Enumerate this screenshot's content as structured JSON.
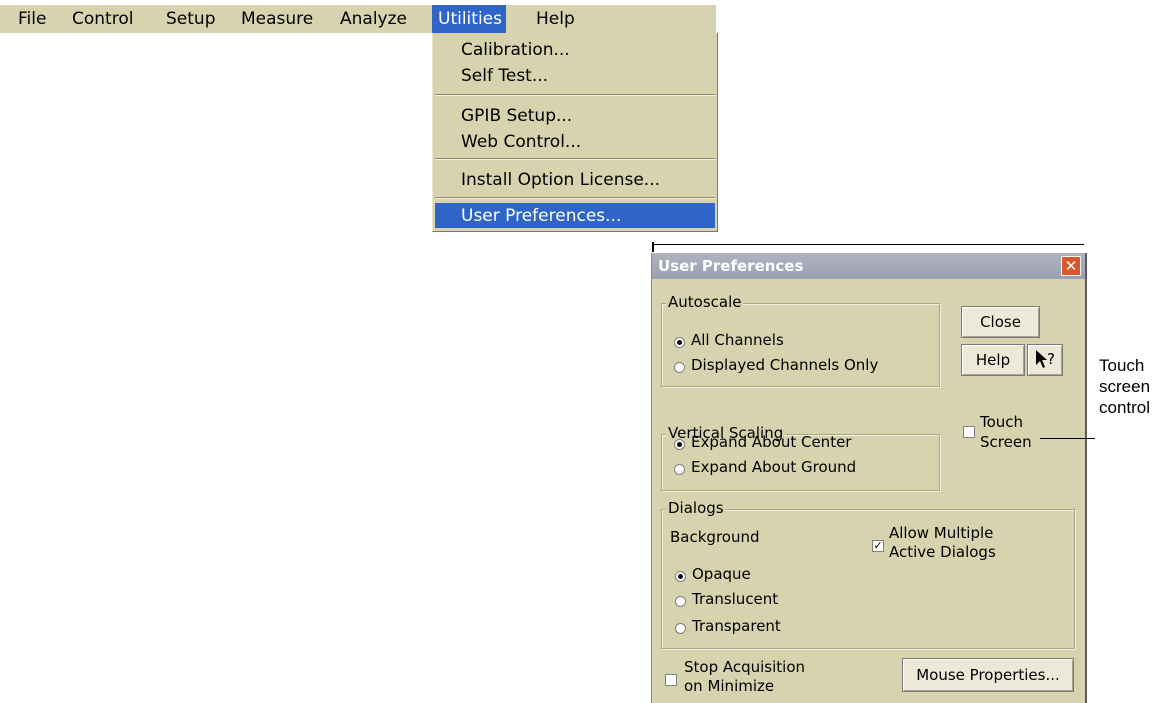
{
  "menubar": {
    "items": [
      "File",
      "Control",
      "Setup",
      "Measure",
      "Analyze",
      "Utilities",
      "Help"
    ],
    "active": "Utilities"
  },
  "dropdown": {
    "items": [
      "Calibration...",
      "Self Test...",
      "GPIB Setup...",
      "Web Control...",
      "Install Option License...",
      "User Preferences..."
    ],
    "highlighted": "User Preferences..."
  },
  "dialog": {
    "title": "User Preferences",
    "close_glyph": "✕",
    "autoscale": {
      "label": "Autoscale",
      "options": [
        "All Channels",
        "Displayed Channels Only"
      ],
      "selected": "All Channels"
    },
    "vertical_scaling": {
      "label": "Vertical Scaling",
      "options": [
        "Expand About Center",
        "Expand About Ground"
      ],
      "selected": "Expand About Center"
    },
    "touch_screen": {
      "label_line1": "Touch",
      "label_line2": "Screen",
      "checked": false
    },
    "buttons": {
      "close": "Close",
      "help": "Help",
      "whats_this": "?"
    },
    "dialogs_group": {
      "label": "Dialogs",
      "background_label": "Background",
      "options": [
        "Opaque",
        "Translucent",
        "Transparent"
      ],
      "selected": "Opaque",
      "allow_multiple": {
        "line1": "Allow Multiple",
        "line2": "Active Dialogs",
        "checked": true
      }
    },
    "stop_acquisition": {
      "line1": "Stop Acquisition",
      "line2": "on Minimize",
      "checked": false
    },
    "mouse_properties": "Mouse Properties..."
  },
  "callout": {
    "line1": "Touch",
    "line2": "screen",
    "line3": "control"
  },
  "colors": {
    "menu_bg": "#d6d3ae",
    "highlight": "#2f64c8",
    "title_bar": "#a6a9b8"
  }
}
